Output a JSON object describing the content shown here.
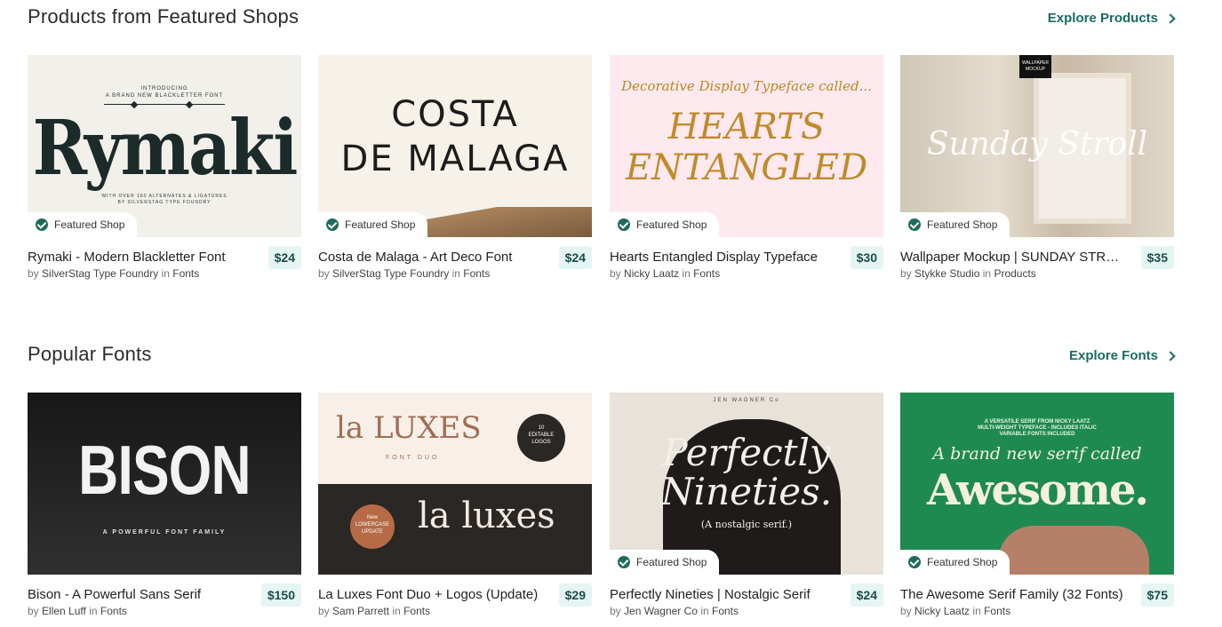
{
  "sections": [
    {
      "title": "Products from Featured Shops",
      "explore_label": "Explore Products",
      "cards": [
        {
          "title": "Rymaki - Modern Blackletter Font",
          "price": "$24",
          "by": "by",
          "author": "SilverStag Type Foundry",
          "in": "in",
          "category": "Fonts",
          "featured": true,
          "badge": "Featured Shop",
          "art": {
            "small_top": "INTRODUCING\nA BRAND NEW BLACKLETTER FONT",
            "main": "Rymaki",
            "small_bottom": "WITH OVER 160 ALTERNATES & LIGATURES\nBY SILVERSTAG TYPE FOUNDRY"
          }
        },
        {
          "title": "Costa de Malaga - Art Deco Font",
          "price": "$24",
          "by": "by",
          "author": "SilverStag Type Foundry",
          "in": "in",
          "category": "Fonts",
          "featured": true,
          "badge": "Featured Shop",
          "art": {
            "main": "COSTA\nDE MALAGA"
          }
        },
        {
          "title": "Hearts Entangled Display Typeface",
          "price": "$30",
          "by": "by",
          "author": "Nicky Laatz",
          "in": "in",
          "category": "Fonts",
          "featured": true,
          "badge": "Featured Shop",
          "art": {
            "small_top": "Decorative Display Typeface called...",
            "main": "HEARTS\nENTANGLED"
          }
        },
        {
          "title": "Wallpaper Mockup | SUNDAY STROLL",
          "price": "$35",
          "by": "by",
          "author": "Stykke Studio",
          "in": "in",
          "category": "Products",
          "featured": true,
          "badge": "Featured Shop",
          "art": {
            "label": "WALLPAPER\nMOCKUP",
            "main": "Sunday Stroll"
          }
        }
      ]
    },
    {
      "title": "Popular Fonts",
      "explore_label": "Explore Fonts",
      "cards": [
        {
          "title": "Bison - A Powerful Sans Serif",
          "price": "$150",
          "by": "by",
          "author": "Ellen Luff",
          "in": "in",
          "category": "Fonts",
          "featured": false,
          "badge": "",
          "art": {
            "main": "BISON",
            "small_bottom": "A POWERFUL FONT FAMILY"
          }
        },
        {
          "title": "La Luxes Font Duo + Logos (Update)",
          "price": "$29",
          "by": "by",
          "author": "Sam Parrett",
          "in": "in",
          "category": "Fonts",
          "featured": false,
          "badge": "",
          "art": {
            "main": "la LUXES",
            "sub": "FONT DUO",
            "circle": "10\nEDITABLE\nLOGOS",
            "new": "New\nLOWERCASE\nUPDATE",
            "main2": "la luxes"
          }
        },
        {
          "title": "Perfectly Nineties | Nostalgic Serif",
          "price": "$24",
          "by": "by",
          "author": "Jen Wagner Co",
          "in": "in",
          "category": "Fonts",
          "featured": true,
          "badge": "Featured Shop",
          "art": {
            "small_top": "JEN WAGNER Co",
            "main": "Perfectly\nNineties.",
            "sub": "(A nostalgic serif.)"
          }
        },
        {
          "title": "The Awesome Serif Family (32 Fonts)",
          "price": "$75",
          "by": "by",
          "author": "Nicky Laatz",
          "in": "in",
          "category": "Fonts",
          "featured": true,
          "badge": "Featured Shop",
          "art": {
            "small_top": "A VERSATILE SERIF FROM NICKY LAATZ\nMULTI-WEIGHT TYPEFACE - INCLUDES ITALIC\nVARIABLE FONTS INCLUDED",
            "main": "A brand new serif called",
            "main2": "Awesome."
          }
        }
      ]
    }
  ],
  "colors": {
    "accent": "#1a6b63",
    "price_bg": "#e5f5f3",
    "badge_icon": "#1f6b5e"
  },
  "icons": {
    "explore_chevron": "chevron-right-icon",
    "badge": "verified-check-icon"
  }
}
